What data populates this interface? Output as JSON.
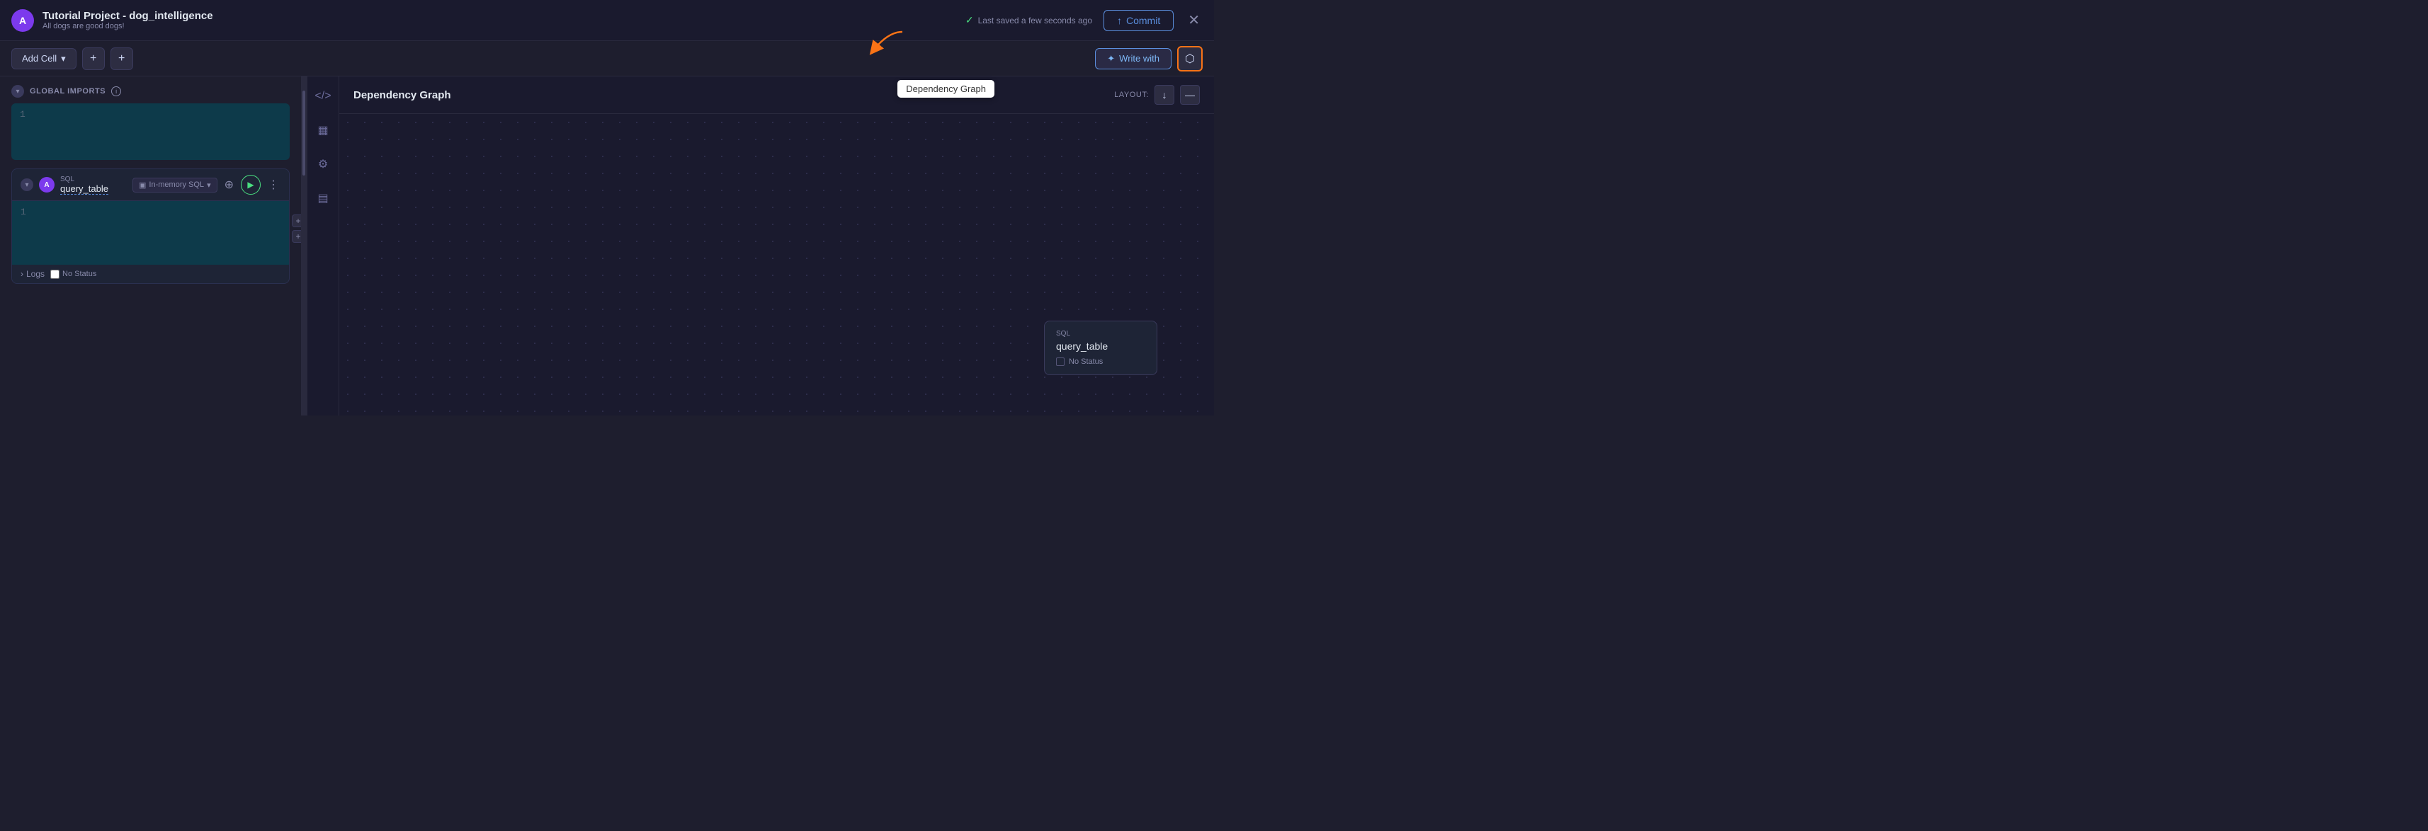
{
  "topbar": {
    "logo_text": "A",
    "title": "Tutorial Project - dog_intelligence",
    "subtitle": "All dogs are good dogs!",
    "saved_text": "Last saved a few seconds ago",
    "commit_label": "Commit",
    "commit_icon": "↑"
  },
  "toolbar": {
    "add_cell_label": "Add Cell",
    "add_cell_chevron": "▾",
    "plus_icon_1": "+",
    "plus_icon_2": "+",
    "write_with_label": "Write with",
    "dep_graph_tooltip": "Dependency Graph"
  },
  "left_panel": {
    "global_imports_title": "GLOBAL IMPORTS",
    "global_imports_info": "i",
    "global_imports_line": "1",
    "sql_cell": {
      "type_label": "SQL",
      "name": "query_table",
      "db_label": "In-memory SQL",
      "logs_label": "Logs",
      "status_label": "No Status"
    }
  },
  "side_icons": [
    {
      "name": "code-icon",
      "symbol": "</>"
    },
    {
      "name": "calendar-icon",
      "symbol": "▦"
    },
    {
      "name": "settings-icon",
      "symbol": "⚙"
    },
    {
      "name": "library-icon",
      "symbol": "▤"
    }
  ],
  "right_panel": {
    "title": "Dependency Graph",
    "layout_label": "LAYOUT:",
    "layout_down_btn": "↓",
    "layout_minus_btn": "—",
    "dep_node": {
      "type": "SQL",
      "name": "query_table",
      "status": "No Status"
    }
  }
}
